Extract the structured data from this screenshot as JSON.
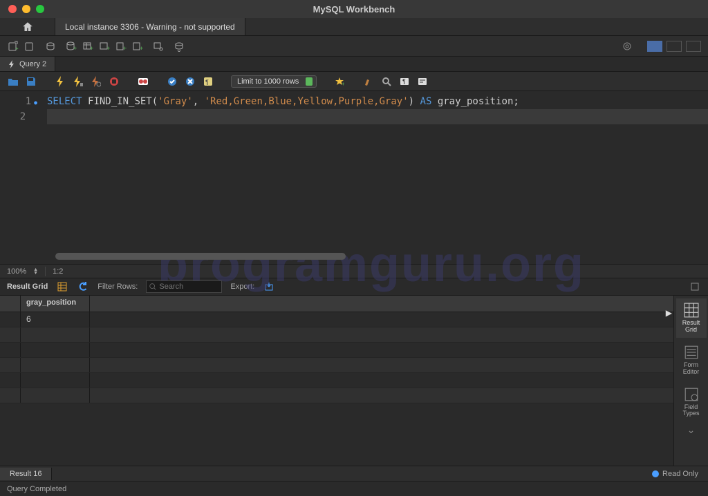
{
  "title": "MySQL Workbench",
  "connection_tab": "Local instance 3306 - Warning - not supported",
  "query_tab": "Query 2",
  "limit_select": "Limit to 1000 rows",
  "sql": {
    "line1_tokens": [
      "SELECT",
      " ",
      "FIND_IN_SET",
      "(",
      "'Gray'",
      ",",
      " ",
      "'Red,Green,Blue,Yellow,Purple,Gray'",
      ")",
      " ",
      "AS",
      " ",
      "gray_position",
      ";"
    ]
  },
  "zoom": "100%",
  "cursor_pos": "1:2",
  "results_header": {
    "label": "Result Grid",
    "filter_label": "Filter Rows:",
    "search_placeholder": "Search",
    "export_label": "Export:"
  },
  "grid": {
    "column": "gray_position",
    "rows": [
      "6"
    ]
  },
  "side_panel": [
    {
      "label": "Result\nGrid"
    },
    {
      "label": "Form\nEditor"
    },
    {
      "label": "Field\nTypes"
    }
  ],
  "result_tab": "Result 16",
  "readonly": "Read Only",
  "status": "Query Completed",
  "watermark": "programguru.org"
}
